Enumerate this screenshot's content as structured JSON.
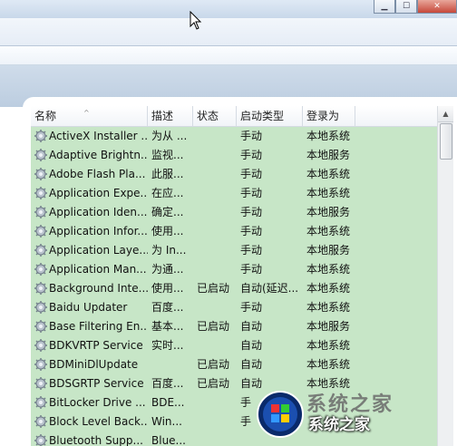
{
  "columns": [
    "名称",
    "描述",
    "状态",
    "启动类型",
    "登录为"
  ],
  "rows": [
    {
      "name": "ActiveX Installer ...",
      "desc": "为从 ...",
      "status": "",
      "startup": "手动",
      "logon": "本地系统"
    },
    {
      "name": "Adaptive Brightn...",
      "desc": "监视...",
      "status": "",
      "startup": "手动",
      "logon": "本地服务"
    },
    {
      "name": "Adobe Flash Pla...",
      "desc": "此服...",
      "status": "",
      "startup": "手动",
      "logon": "本地系统"
    },
    {
      "name": "Application Expe...",
      "desc": "在应...",
      "status": "",
      "startup": "手动",
      "logon": "本地系统"
    },
    {
      "name": "Application Iden...",
      "desc": "确定...",
      "status": "",
      "startup": "手动",
      "logon": "本地服务"
    },
    {
      "name": "Application Infor...",
      "desc": "使用...",
      "status": "",
      "startup": "手动",
      "logon": "本地系统"
    },
    {
      "name": "Application Laye...",
      "desc": "为 In...",
      "status": "",
      "startup": "手动",
      "logon": "本地服务"
    },
    {
      "name": "Application Man...",
      "desc": "为通...",
      "status": "",
      "startup": "手动",
      "logon": "本地系统"
    },
    {
      "name": "Background Inte...",
      "desc": "使用...",
      "status": "已启动",
      "startup": "自动(延迟...",
      "logon": "本地系统"
    },
    {
      "name": "Baidu Updater",
      "desc": "百度...",
      "status": "",
      "startup": "手动",
      "logon": "本地系统"
    },
    {
      "name": "Base Filtering En...",
      "desc": "基本...",
      "status": "已启动",
      "startup": "自动",
      "logon": "本地服务"
    },
    {
      "name": "BDKVRTP Service",
      "desc": "实时...",
      "status": "",
      "startup": "自动",
      "logon": "本地系统"
    },
    {
      "name": "BDMiniDlUpdate",
      "desc": "",
      "status": "已启动",
      "startup": "自动",
      "logon": "本地系统"
    },
    {
      "name": "BDSGRTP Service",
      "desc": "百度...",
      "status": "已启动",
      "startup": "自动",
      "logon": "本地系统"
    },
    {
      "name": "BitLocker Drive ...",
      "desc": "BDE...",
      "status": "",
      "startup": "手",
      "logon": ""
    },
    {
      "name": "Block Level Back...",
      "desc": "Win...",
      "status": "",
      "startup": "手",
      "logon": ""
    },
    {
      "name": "Bluetooth Supp...",
      "desc": "Blue...",
      "status": "",
      "startup": "",
      "logon": ""
    }
  ],
  "watermark": {
    "text": "系统之家",
    "faded": "系统之家"
  },
  "colors": {
    "list_bg": "#c7e6c7",
    "header_band": "#c5d4e6"
  },
  "icons": {
    "row": "gear-icon",
    "cursor": "mouse-pointer-icon",
    "logo": "windows-logo-icon"
  }
}
